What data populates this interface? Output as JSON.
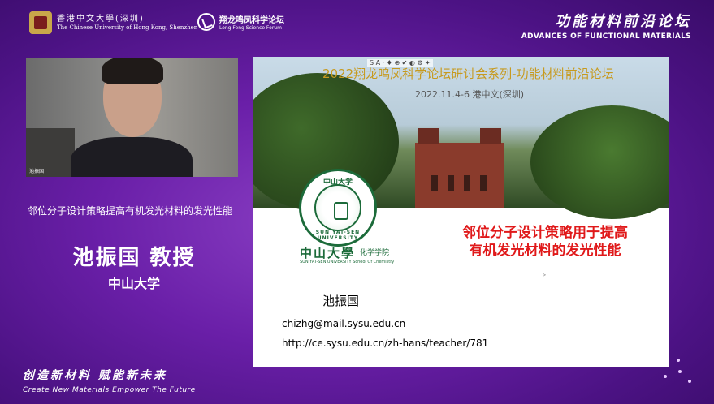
{
  "header": {
    "cuhk_cn": "香港中文大學(深圳)",
    "cuhk_en": "The Chinese University of Hong Kong, Shenzhen",
    "longfeng_cn": "翔龙鸣凤科学论坛",
    "longfeng_en": "Long Feng Science Forum",
    "forum_cn": "功能材料前沿论坛",
    "forum_en": "ADVANCES OF FUNCTIONAL MATERIALS"
  },
  "webcam": {
    "label": "池振国"
  },
  "left_panel": {
    "talk_title": "邻位分子设计策略提高有机发光材料的发光性能",
    "speaker": "池振国 教授",
    "affiliation": "中山大学"
  },
  "slide": {
    "toolbar": "S A · ♦ ⊕ ✔ ◐ ⚙ ✦",
    "title": "2022翔龙鸣凤科学论坛研讨会系列-功能材料前沿论坛",
    "date": "2022.11.4-6 港中文(深圳)",
    "seal_top": "中山大学",
    "seal_bottom": "SUN YAT-SEN UNIVERSITY",
    "university": "中山大學",
    "school": "化学学院",
    "university_en": "SUN YAT-SEN UNIVERSITY   School Of Chemistry",
    "talk_title_line1": "邻位分子设计策略用于提高",
    "talk_title_line2": "有机发光材料的发光性能",
    "speaker": "池振国",
    "email": "chizhg@mail.sysu.edu.cn",
    "url": "http://ce.sysu.edu.cn/zh-hans/teacher/781"
  },
  "footer": {
    "slogan_cn": "创造新材料  赋能新未来",
    "slogan_en": "Create New Materials   Empower The Future"
  },
  "colors": {
    "background": "#6a1fa8",
    "slide_title": "#c79a1e",
    "slide_talk": "#e0191a",
    "sysu_green": "#1c6b3a"
  }
}
